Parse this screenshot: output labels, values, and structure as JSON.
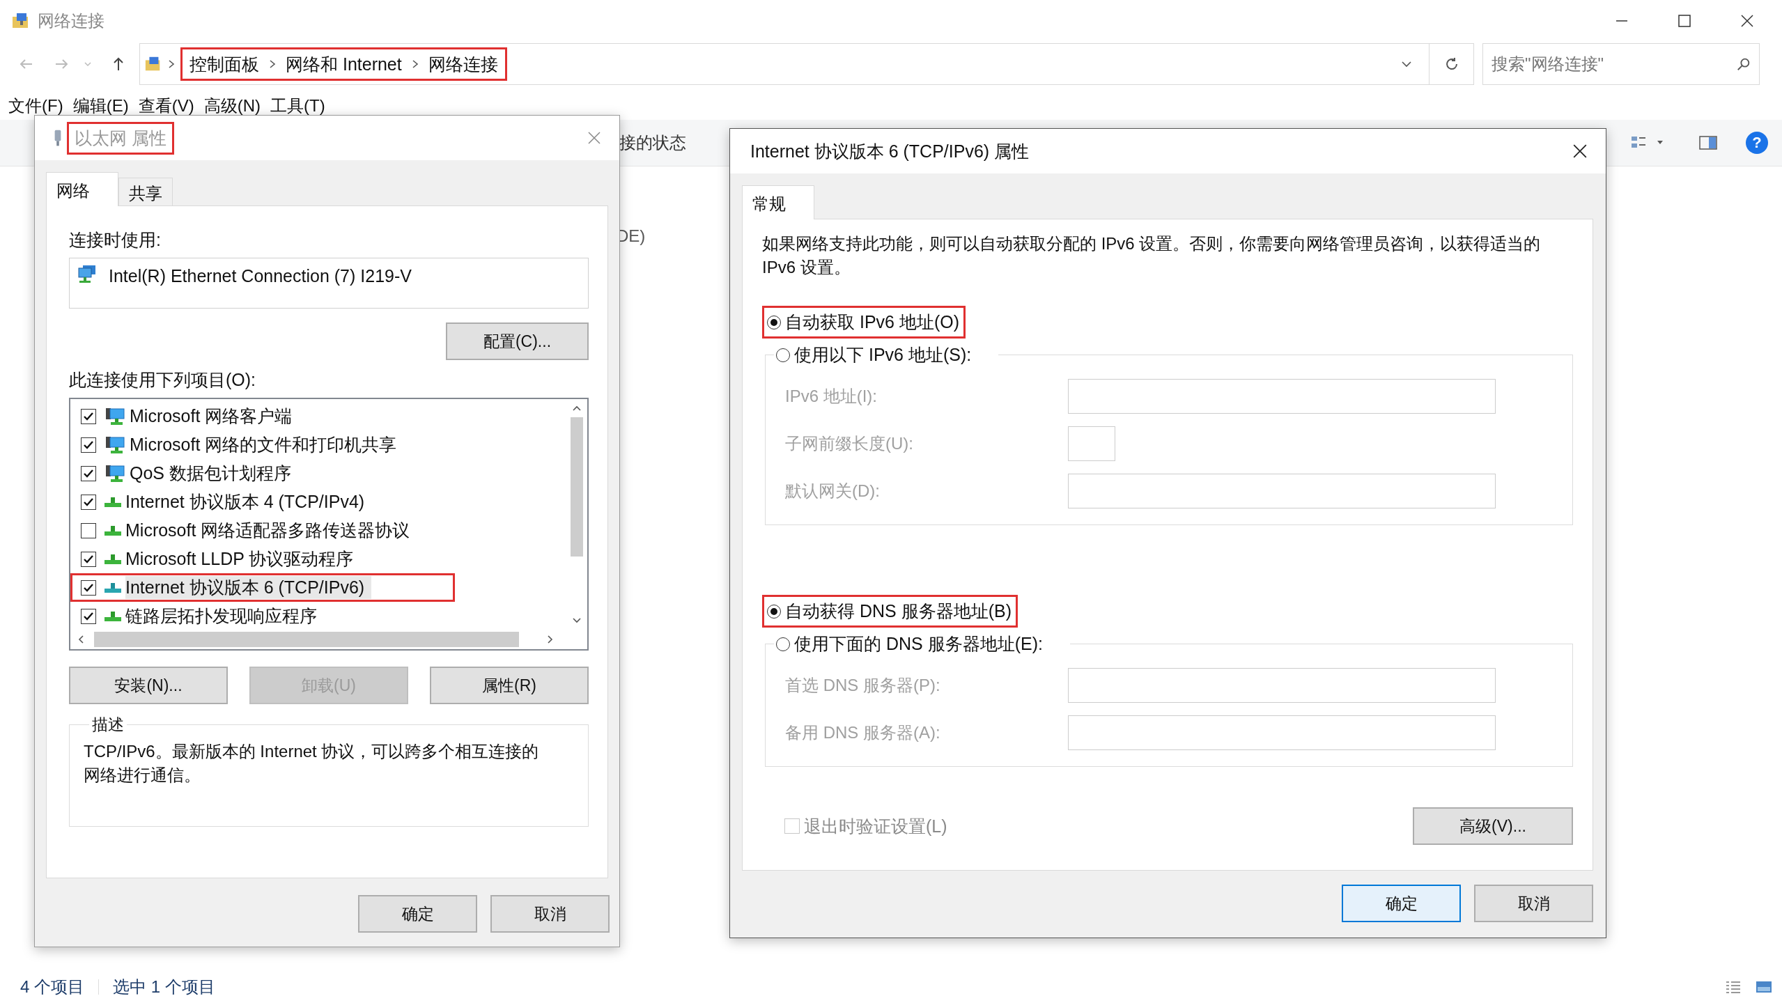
{
  "window": {
    "title": "网络连接",
    "active": false
  },
  "address_bar": {
    "highlighted": true,
    "breadcrumb": [
      "控制面板",
      "网络和 Internet",
      "网络连接"
    ]
  },
  "search": {
    "placeholder": "搜索\"网络连接\""
  },
  "menu": [
    "文件(F)",
    "编辑(E)",
    "查看(V)",
    "高级(N)",
    "工具(T)"
  ],
  "background_texts": [
    "接的状态",
    "DE)"
  ],
  "help": "?",
  "status_bar": [
    "4 个项目",
    "选中 1 个项目"
  ],
  "ethernet_dialog": {
    "title": "以太网 属性",
    "title_highlighted": true,
    "active": false,
    "tabs": [
      {
        "label": "网络",
        "selected": true
      },
      {
        "label": "共享",
        "selected": false
      }
    ],
    "connect_using_label": "连接时使用:",
    "adapter": "Intel(R) Ethernet Connection (7) I219-V",
    "configure_button": "配置(C)...",
    "items_label": "此连接使用下列项目(O):",
    "items": [
      {
        "label": "Microsoft 网络客户端",
        "kind": "client",
        "checked": true,
        "selected": false,
        "highlighted": false
      },
      {
        "label": "Microsoft 网络的文件和打印机共享",
        "kind": "client",
        "checked": true,
        "selected": false,
        "highlighted": false
      },
      {
        "label": "QoS 数据包计划程序",
        "kind": "client",
        "checked": true,
        "selected": false,
        "highlighted": false
      },
      {
        "label": "Internet 协议版本 4 (TCP/IPv4)",
        "kind": "protocol",
        "checked": true,
        "selected": false,
        "highlighted": false
      },
      {
        "label": "Microsoft 网络适配器多路传送器协议",
        "kind": "protocol",
        "checked": false,
        "selected": false,
        "highlighted": false
      },
      {
        "label": "Microsoft LLDP 协议驱动程序",
        "kind": "protocol",
        "checked": true,
        "selected": false,
        "highlighted": false
      },
      {
        "label": "Internet 协议版本 6 (TCP/IPv6)",
        "kind": "protocol",
        "checked": true,
        "selected": true,
        "highlighted": true
      },
      {
        "label": "链路层拓扑发现响应程序",
        "kind": "protocol",
        "checked": true,
        "selected": false,
        "highlighted": false
      }
    ],
    "buttons": [
      {
        "label": "安装(N)...",
        "disabled": false
      },
      {
        "label": "卸载(U)",
        "disabled": true
      },
      {
        "label": "属性(R)",
        "disabled": false
      }
    ],
    "description": {
      "title": "描述",
      "text": "TCP/IPv6。最新版本的 Internet 协议，可以跨多个相互连接的网络进行通信。"
    },
    "footer_buttons": [
      {
        "label": "确定",
        "default": false
      },
      {
        "label": "取消",
        "default": false
      }
    ]
  },
  "ipv6_dialog": {
    "title": "Internet 协议版本 6 (TCP/IPv6) 属性",
    "active": true,
    "tabs": [
      {
        "label": "常规",
        "selected": true
      }
    ],
    "intro": "如果网络支持此功能，则可以自动获取分配的 IPv6 设置。否则，你需要向网络管理员咨询，以获得适当的 IPv6 设置。",
    "address_options": [
      {
        "label": "自动获取 IPv6 地址(O)",
        "selected": true,
        "highlighted": true
      },
      {
        "label": "使用以下 IPv6 地址(S):",
        "selected": false,
        "highlighted": false
      }
    ],
    "address_fields": [
      {
        "label": "IPv6 地址(I):",
        "kind": "wide"
      },
      {
        "label": "子网前缀长度(U):",
        "kind": "short"
      },
      {
        "label": "默认网关(D):",
        "kind": "wide"
      }
    ],
    "address_fields_disabled": true,
    "dns_options": [
      {
        "label": "自动获得 DNS 服务器地址(B)",
        "selected": true,
        "highlighted": true
      },
      {
        "label": "使用下面的 DNS 服务器地址(E):",
        "selected": false,
        "highlighted": false
      }
    ],
    "dns_fields": [
      {
        "label": "首选 DNS 服务器(P):",
        "kind": "wide"
      },
      {
        "label": "备用 DNS 服务器(A):",
        "kind": "wide"
      }
    ],
    "dns_fields_disabled": true,
    "validate": {
      "label": "退出时验证设置(L)",
      "checked": false,
      "disabled": true
    },
    "advanced_button": "高级(V)...",
    "footer_buttons": [
      {
        "label": "确定",
        "default": true
      },
      {
        "label": "取消",
        "default": false
      }
    ]
  }
}
